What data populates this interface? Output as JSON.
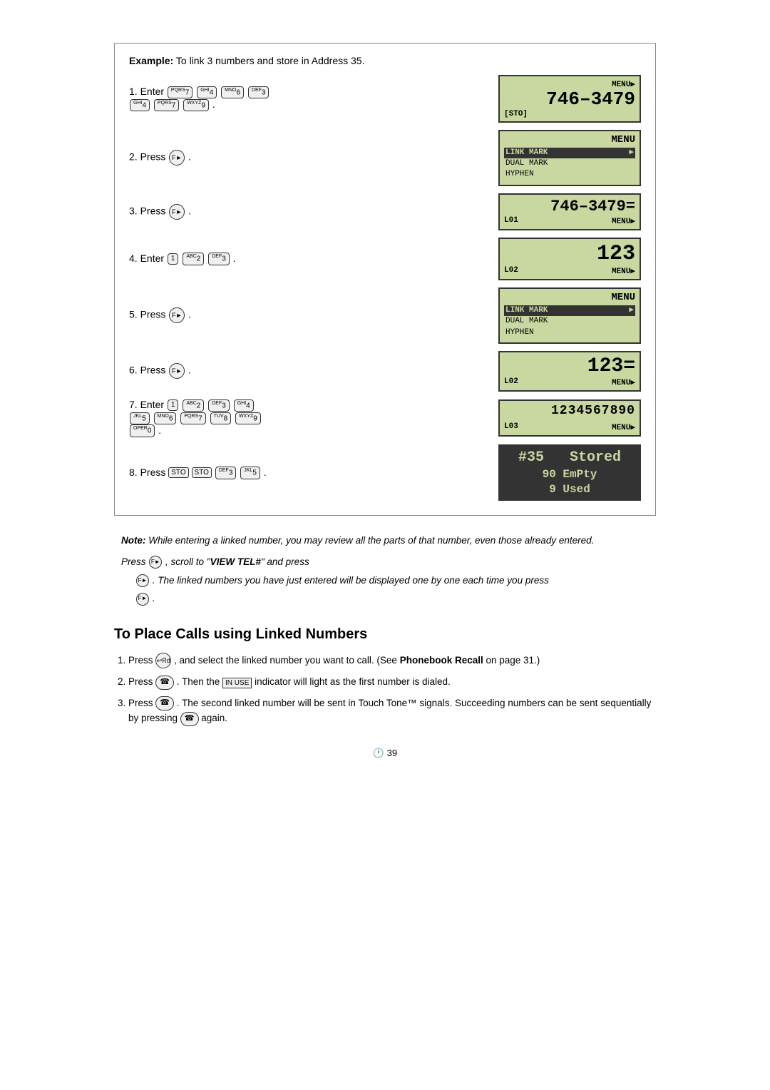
{
  "page": {
    "example_label": "Example:",
    "example_desc": "To link 3 numbers and store in Address 35.",
    "steps": [
      {
        "num": "1",
        "text_html": "Enter <kbd>7</kbd><kbd>4</kbd><kbd>6</kbd><kbd>3</kbd> <kbd>4</kbd><kbd>7</kbd><kbd>9</kbd>.",
        "screen_type": "lcd_number",
        "screen_main": "746–3479",
        "screen_top": "MENU▶",
        "screen_bottom_left": "[STO]",
        "screen_bottom_right": ""
      },
      {
        "num": "2",
        "text": "Press",
        "screen_type": "lcd_menu",
        "screen_top": "MENU",
        "screen_items": [
          "LINK MARK ▶",
          "DUAL MARK",
          "HYPHEN"
        ]
      },
      {
        "num": "3",
        "text": "Press",
        "screen_type": "lcd_number2",
        "screen_main": "746–3479=",
        "screen_bottom_left": "L01",
        "screen_bottom_right": "MENU▶"
      },
      {
        "num": "4",
        "text_plain": "Enter 1  2ABC  3DEF .",
        "screen_type": "lcd_number3",
        "screen_main": "123",
        "screen_bottom_left": "L02",
        "screen_bottom_right": "MENU▶"
      },
      {
        "num": "5",
        "text": "Press",
        "screen_type": "lcd_menu",
        "screen_top": "MENU",
        "screen_items": [
          "LINK MARK ▶",
          "DUAL MARK",
          "HYPHEN"
        ]
      },
      {
        "num": "6",
        "text": "Press",
        "screen_type": "lcd_number4",
        "screen_main": "123=",
        "screen_bottom_left": "L02",
        "screen_bottom_right": "MENU▶"
      },
      {
        "num": "7",
        "text_plain": "Enter 1  2ABC  3DEF  4GHI  5JKL  6MNO  7PQRS  8TUV  9WXYZ  0OPER.",
        "screen_type": "lcd_number5",
        "screen_main": "1234567890",
        "screen_bottom_left": "L03",
        "screen_bottom_right": "MENU▶"
      },
      {
        "num": "8",
        "text_plain": "Press STO STO 3DEF 5JKL .",
        "screen_type": "lcd_stored",
        "stored_line1": "#35   Stored",
        "stored_line2": "90 EmPty",
        "stored_line3": "9 Used"
      }
    ],
    "note_label": "Note:",
    "note_text1": "While entering a linked number, you may review all the parts of that number, even those already entered.",
    "note_text2": "Press",
    "note_text3": ", scroll to “VIEW TEL#” and press",
    "note_text4": ". The linked numbers you have just entered will be displayed one by one each time you press",
    "note_text5": ".",
    "section_title": "To Place Calls using Linked Numbers",
    "place_calls": [
      {
        "num": "1",
        "text": "Press",
        "mid": ", and select the linked number you want to call. (See",
        "bold_text": "Phonebook Recall",
        "end": "on page 31.)"
      },
      {
        "num": "2",
        "text": "Press",
        "mid": ". Then the",
        "code": "IN USE",
        "end": "indicator will light as the first number is dialed."
      },
      {
        "num": "3",
        "text": "Press",
        "end": ". The second linked number will be sent in Touch Tone™ signals. Succeeding numbers can be sent sequentially by pressing",
        "end2": "again."
      }
    ],
    "page_number": "39"
  }
}
